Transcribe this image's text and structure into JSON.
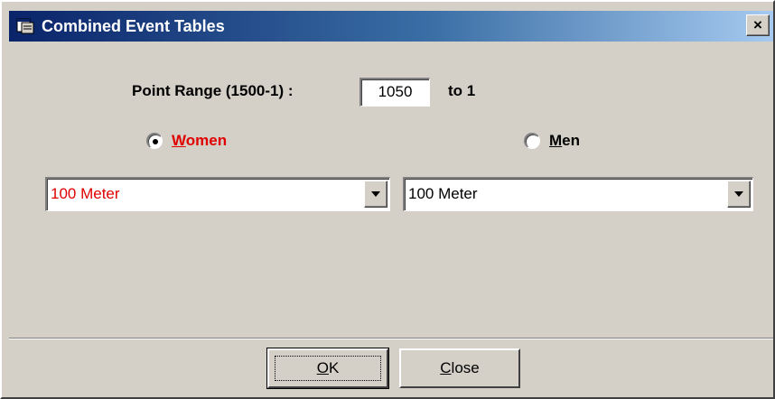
{
  "window": {
    "title": "Combined Event Tables",
    "close_label": "×",
    "title_icon": "tables-app-icon"
  },
  "point_range": {
    "label": "Point Range (1500-1) :",
    "value": "1050",
    "suffix": "to 1"
  },
  "gender": {
    "women": {
      "mnemonic": "W",
      "rest": "omen",
      "selected": true,
      "color": "#e00000"
    },
    "men": {
      "mnemonic": "M",
      "rest": "en",
      "selected": false
    }
  },
  "events": {
    "women_selected": "100 Meter",
    "men_selected": "100 Meter",
    "women_color": "#e00000"
  },
  "buttons": {
    "ok": {
      "mnemonic": "O",
      "rest": "K"
    },
    "close": {
      "mnemonic": "C",
      "rest": "lose"
    }
  },
  "icons": {
    "dropdown": "chevron-down-icon"
  }
}
